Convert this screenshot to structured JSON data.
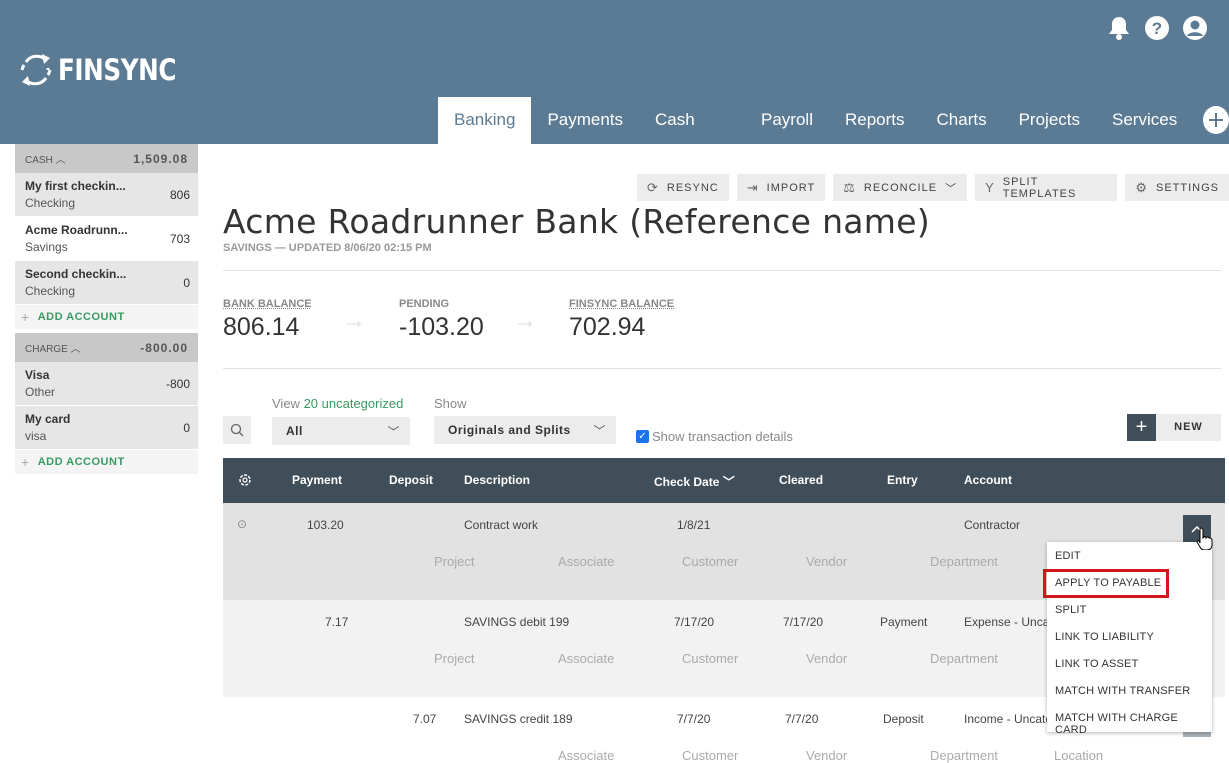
{
  "app": {
    "logo": "FINSYNC"
  },
  "nav": {
    "tabs": [
      "Banking",
      "Payments",
      "Cash Flow",
      "Payroll",
      "Reports",
      "Charts",
      "Projects",
      "Services"
    ]
  },
  "sidebar": {
    "cash": {
      "label": "CASH",
      "amount": "1,509.08"
    },
    "cash_accounts": [
      {
        "name": "My first checkin...",
        "type": "Checking",
        "value": "806"
      },
      {
        "name": "Acme Roadrunn...",
        "type": "Savings",
        "value": "703"
      },
      {
        "name": "Second checkin...",
        "type": "Checking",
        "value": "0"
      }
    ],
    "add_account": "ADD ACCOUNT",
    "charge": {
      "label": "CHARGE",
      "amount": "-800.00"
    },
    "charge_accounts": [
      {
        "name": "Visa",
        "type": "Other",
        "value": "-800"
      },
      {
        "name": "My card",
        "type": "visa",
        "value": "0"
      }
    ]
  },
  "toolbar": {
    "resync": "RESYNC",
    "import": "IMPORT",
    "reconcile": "RECONCILE",
    "split_templates": "SPLIT TEMPLATES",
    "settings": "SETTINGS"
  },
  "account": {
    "title": "Acme Roadrunner Bank (Reference name)",
    "subtitle": "SAVINGS — UPDATED 8/06/20 02:15 PM"
  },
  "balances": {
    "bank_label": "BANK BALANCE",
    "bank": "806.14",
    "pending_label": "PENDING",
    "pending": "-103.20",
    "finsync_label": "FINSYNC BALANCE",
    "finsync": "702.94"
  },
  "filters": {
    "view_prefix": "View",
    "view_count": "20 uncategorized",
    "view_value": "All",
    "show_label": "Show",
    "show_value": "Originals and Splits",
    "details_label": "Show transaction details",
    "new": "NEW"
  },
  "table": {
    "headers": {
      "payment": "Payment",
      "deposit": "Deposit",
      "description": "Description",
      "check_date": "Check Date",
      "cleared": "Cleared",
      "entry": "Entry",
      "account": "Account"
    },
    "sub_labels": {
      "project": "Project",
      "associate": "Associate",
      "customer": "Customer",
      "vendor": "Vendor",
      "department": "Department",
      "location": "Location"
    },
    "rows": [
      {
        "payment": "103.20",
        "deposit": "",
        "description": "Contract work",
        "check_date": "1/8/21",
        "cleared": "",
        "entry": "",
        "account": "Contractor"
      },
      {
        "payment": "7.17",
        "deposit": "",
        "description": "SAVINGS debit 199",
        "check_date": "7/17/20",
        "cleared": "7/17/20",
        "entry": "Payment",
        "account": "Expense - Uncat"
      },
      {
        "payment": "",
        "deposit": "7.07",
        "description": "SAVINGS credit 189",
        "check_date": "7/7/20",
        "cleared": "7/7/20",
        "entry": "Deposit",
        "account": "Income - Uncate"
      }
    ]
  },
  "menu": [
    "EDIT",
    "APPLY TO PAYABLE",
    "SPLIT",
    "LINK TO LIABILITY",
    "LINK TO ASSET",
    "MATCH WITH TRANSFER",
    "MATCH WITH CHARGE CARD"
  ]
}
